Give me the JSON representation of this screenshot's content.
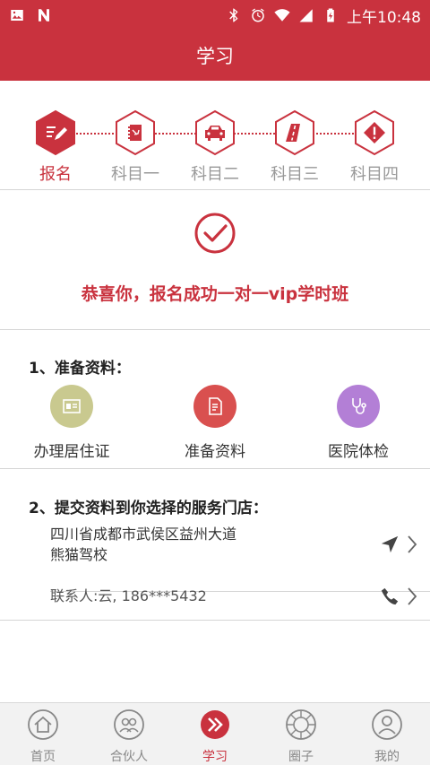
{
  "status_bar": {
    "time": "上午10:48",
    "left_icons": [
      "image-icon",
      "n-icon"
    ],
    "right_icons": [
      "bluetooth-icon",
      "alarm-icon",
      "wifi-icon",
      "signal-icon",
      "battery-icon"
    ]
  },
  "header": {
    "title": "学习"
  },
  "steps": [
    {
      "label": "报名",
      "icon": "signup-icon",
      "active": true
    },
    {
      "label": "科目一",
      "icon": "notebook-icon",
      "active": false
    },
    {
      "label": "科目二",
      "icon": "car-icon",
      "active": false
    },
    {
      "label": "科目三",
      "icon": "road-icon",
      "active": false
    },
    {
      "label": "科目四",
      "icon": "warning-icon",
      "active": false
    }
  ],
  "success": {
    "message": "恭喜你，报名成功一对一vip学时班"
  },
  "prepare": {
    "title": "1、准备资料：",
    "items": [
      {
        "label": "办理居住证",
        "icon": "id-card-icon",
        "color": "#c9c98f"
      },
      {
        "label": "准备资料",
        "icon": "document-icon",
        "color": "#d9504f"
      },
      {
        "label": "医院体检",
        "icon": "stethoscope-icon",
        "color": "#b37fd6"
      }
    ]
  },
  "submit": {
    "title": "2、提交资料到你选择的服务门店：",
    "address_line1": "四川省成都市武侯区益州大道",
    "address_line2": "熊猫驾校",
    "contact": "联系人:云, 186***5432"
  },
  "tabs": [
    {
      "label": "首页",
      "icon": "home-icon",
      "active": false
    },
    {
      "label": "合伙人",
      "icon": "partner-icon",
      "active": false
    },
    {
      "label": "学习",
      "icon": "study-icon",
      "active": true
    },
    {
      "label": "圈子",
      "icon": "circle-icon",
      "active": false
    },
    {
      "label": "我的",
      "icon": "profile-icon",
      "active": false
    }
  ],
  "colors": {
    "brand": "#c9323e",
    "divider": "#d6d6d6",
    "tab_bg": "#f2f2f2"
  }
}
